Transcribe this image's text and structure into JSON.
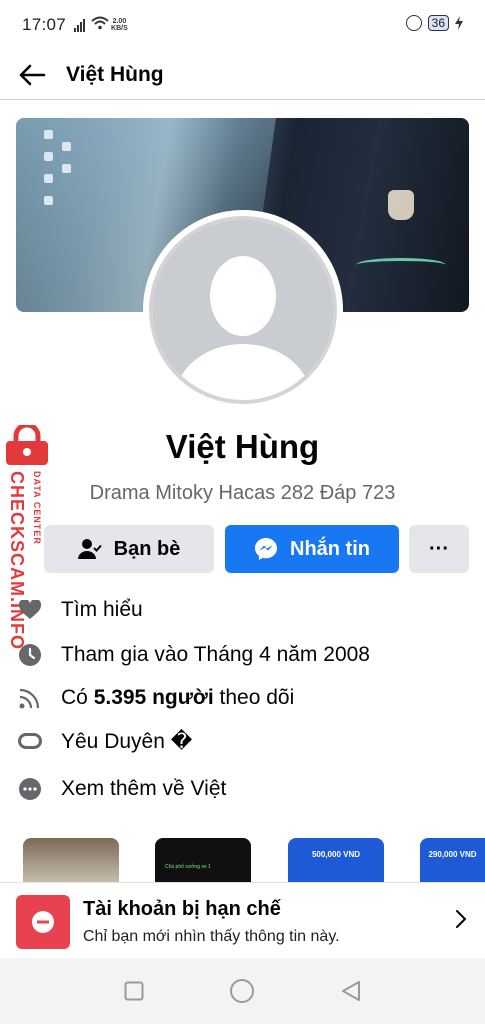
{
  "status": {
    "time": "17:07",
    "speed_top": "2.00",
    "speed_unit": "KB/S",
    "battery": "36"
  },
  "header": {
    "title": "Việt Hùng"
  },
  "profile": {
    "name": "Việt Hùng",
    "bio": "Drama Mitoky Hacas 282 Đáp 723"
  },
  "watermark": {
    "brand": "CHECKSCAM.INFO",
    "sub": "DATA CENTER"
  },
  "buttons": {
    "friends_label": "Bạn bè",
    "message_label": "Nhắn tin",
    "more_label": "···"
  },
  "info": {
    "about": "Tìm hiểu",
    "joined": "Tham gia vào Tháng 4 năm 2008",
    "followers_prefix": "Có ",
    "followers_count": "5.395 người",
    "followers_suffix": " theo dõi",
    "relationship": "Yêu Duyên �",
    "see_more": "Xem thêm về Việt"
  },
  "thumbnails": {
    "t2_text": "Chú phố xưởng xe 1",
    "t3_amount": "500,000 VND",
    "t4_amount": "290,000 VND"
  },
  "banner": {
    "title": "Tài khoản bị hạn chế",
    "subtitle": "Chỉ bạn mới nhìn thấy thông tin này."
  },
  "icons": {
    "back": "arrow-left-icon",
    "friends": "person-check-icon",
    "messenger": "messenger-icon",
    "about": "heart-icon",
    "joined": "clock-icon",
    "followers": "rss-icon",
    "relationship": "ring-icon",
    "see_more": "ellipsis-circle-icon",
    "banner": "minus-circle-icon",
    "chevron": "chevron-right-icon"
  },
  "colors": {
    "accent": "#1877f2",
    "watermark": "#e23a3a",
    "banner_icon": "#e8414f"
  }
}
